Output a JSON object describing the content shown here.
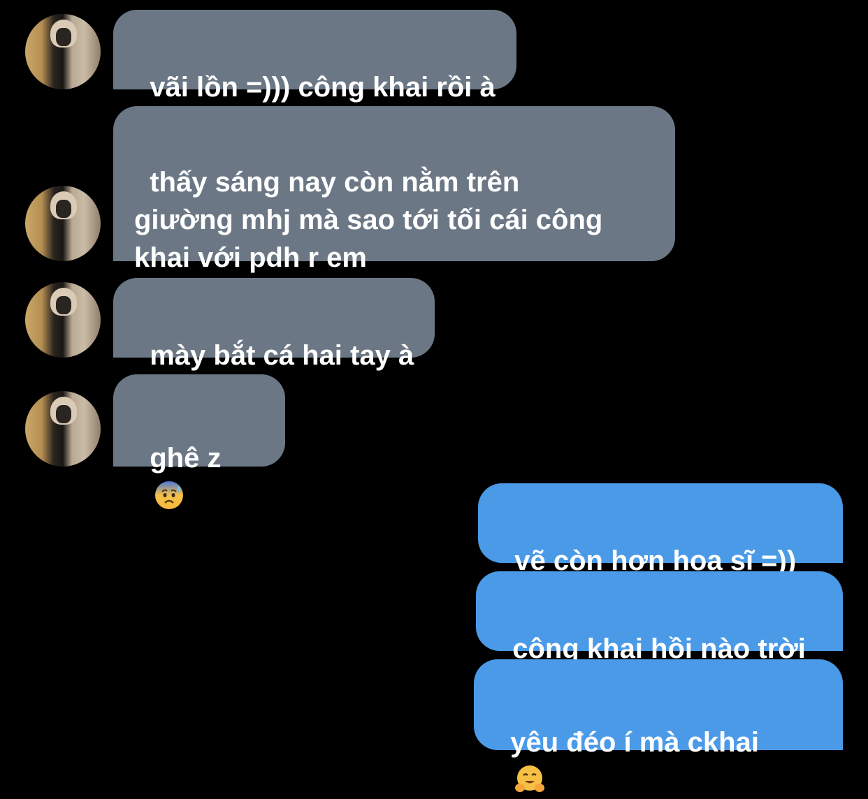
{
  "conversation": {
    "messages": [
      {
        "text": "vãi lồn =))) công khai rồi à"
      },
      {
        "text": "thấy sáng nay còn nằm trên\ngiường mhj mà sao tới tối cái công\nkhai với pdh r em"
      },
      {
        "text": "mày bắt cá hai tay à"
      },
      {
        "text": "ghê z",
        "emoji": "anxious-face-with-sweat-icon"
      },
      {
        "text": "vẽ còn hơn hoạ sĩ =))"
      },
      {
        "text": "công khai hồi nào trời"
      },
      {
        "text": "yêu đéo í mà ckhai",
        "emoji": "hugging-face-icon"
      }
    ]
  },
  "colors": {
    "background": "#000000",
    "incoming_bubble": "#6b7785",
    "outgoing_bubble": "#4a9ae8",
    "text": "#ffffff"
  }
}
